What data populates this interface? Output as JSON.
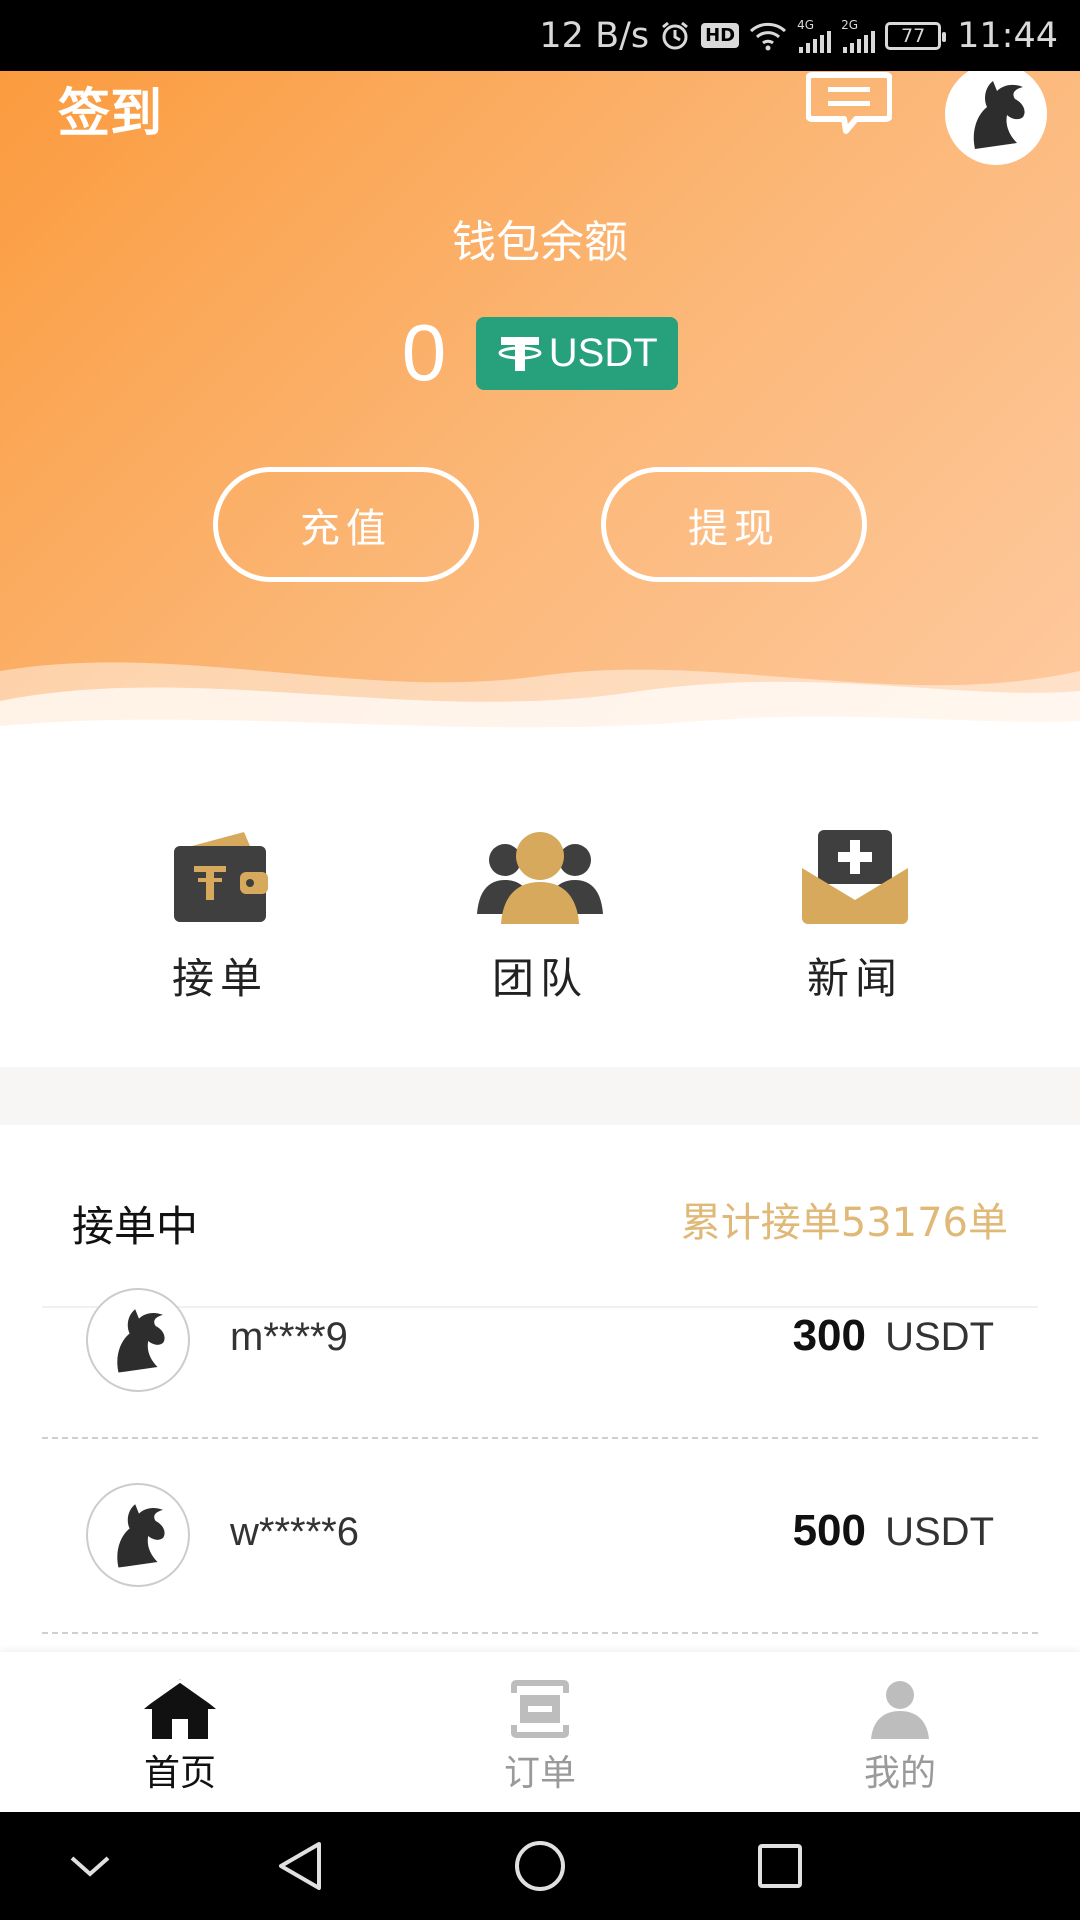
{
  "status_bar": {
    "speed": "12 B/s",
    "hd": "HD",
    "net1": "4G",
    "net2": "2G",
    "battery": "77",
    "time": "11:44"
  },
  "header": {
    "signin_label": "签到",
    "wallet_label": "钱包余额",
    "balance": "0",
    "currency": "USDT",
    "recharge_label": "充值",
    "withdraw_label": "提现",
    "gradient_colors": [
      "#fb9b3e",
      "#fecaa0"
    ]
  },
  "menu": {
    "items": [
      {
        "label": "接单",
        "icon": "wallet-icon"
      },
      {
        "label": "团队",
        "icon": "team-icon"
      },
      {
        "label": "新闻",
        "icon": "mail-icon"
      }
    ]
  },
  "orders": {
    "title": "接单中",
    "total": "累计接单53176单",
    "rows": [
      {
        "name": "m****9",
        "amount": "300",
        "unit": "USDT"
      },
      {
        "name": "w*****6",
        "amount": "500",
        "unit": "USDT"
      }
    ]
  },
  "tabbar": {
    "tabs": [
      {
        "label": "首页",
        "icon": "home-icon",
        "active": true
      },
      {
        "label": "订单",
        "icon": "order-icon",
        "active": false
      },
      {
        "label": "我的",
        "icon": "profile-icon",
        "active": false
      }
    ]
  },
  "colors": {
    "accent_gold": "#e0b877",
    "usdt_green": "#26a17b",
    "icon_dark": "#3a3a3a"
  }
}
